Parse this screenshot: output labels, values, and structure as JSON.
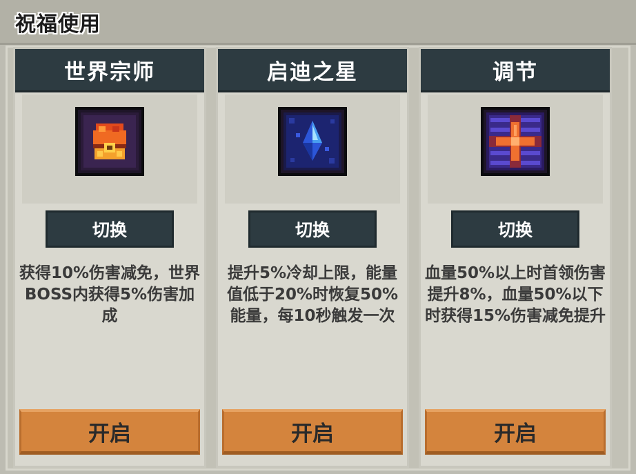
{
  "header": {
    "title": "祝福使用"
  },
  "cards": [
    {
      "title": "世界宗师",
      "icon": "chest-icon",
      "switch_label": "切换",
      "description": "获得10%伤害减免，世界BOSS内获得5%伤害加成",
      "enable_label": "开启"
    },
    {
      "title": "启迪之星",
      "icon": "blue-crystal-icon",
      "switch_label": "切换",
      "description": "提升5%冷却上限，能量值低于20%时恢复50%能量，每10秒触发一次",
      "enable_label": "开启"
    },
    {
      "title": "调节",
      "icon": "orange-cross-icon",
      "switch_label": "切换",
      "description": "血量50%以上时首领伤害提升8%，血量50%以下时获得15%伤害减免提升",
      "enable_label": "开启"
    }
  ],
  "colors": {
    "title_bar": "#2d3b41",
    "button_orange": "#d4843d",
    "background": "#bdbcb2"
  }
}
